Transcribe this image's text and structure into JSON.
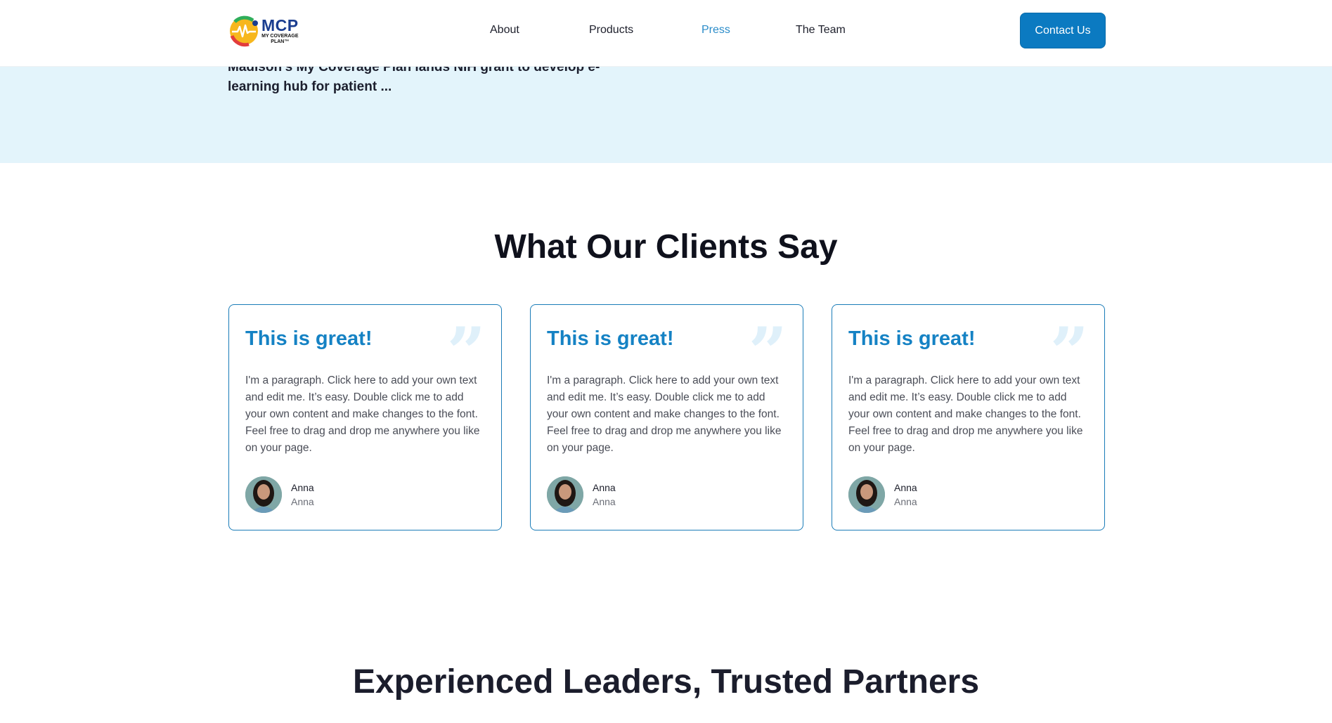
{
  "header": {
    "logo": {
      "mark": "MCP",
      "subtitle_line1": "MY COVERAGE",
      "subtitle_line2": "PLAN™"
    },
    "nav": [
      {
        "label": "About",
        "active": false
      },
      {
        "label": "Products",
        "active": false
      },
      {
        "label": "Press",
        "active": true
      },
      {
        "label": "The Team",
        "active": false
      }
    ],
    "contact_label": "Contact Us"
  },
  "press": {
    "headline": "Madison’s My Coverage Plan lands NIH grant to develop e-learning hub for patient ..."
  },
  "testimonials": {
    "heading": "What Our Clients Say",
    "cards": [
      {
        "title": "This is great!",
        "text": "I'm a paragraph. Click here to add your own text and edit me. It’s easy. Double click me to add your own content and make changes to the font. Feel free to drag and drop me anywhere you like on your page.",
        "name": "Anna",
        "role": "Anna"
      },
      {
        "title": "This is great!",
        "text": "I'm a paragraph. Click here to add your own text and edit me. It’s easy. Double click me to add your own content and make changes to the font. Feel free to drag and drop me anywhere you like on your page.",
        "name": "Anna",
        "role": "Anna"
      },
      {
        "title": "This is great!",
        "text": "I'm a paragraph. Click here to add your own text and edit me. It’s easy. Double click me to add your own content and make changes to the font. Feel free to drag and drop me anywhere you like on your page.",
        "name": "Anna",
        "role": "Anna"
      }
    ]
  },
  "leaders": {
    "heading": "Experienced Leaders, Trusted Partners"
  },
  "colors": {
    "accent": "#0b7ac1",
    "card_border": "#1a7cb8",
    "title_blue": "#1582c4",
    "band": "#e3f4fb"
  },
  "icons": {
    "quote": "quote-icon",
    "avatar": "avatar-photo"
  }
}
